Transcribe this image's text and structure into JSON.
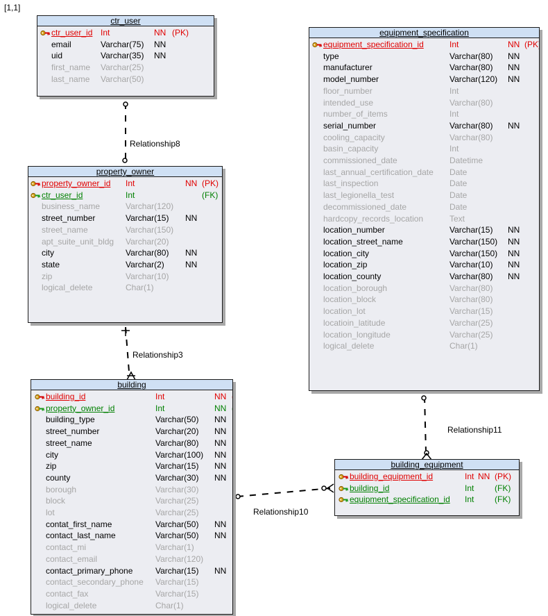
{
  "corner_label": "[1,1]",
  "colors": {
    "header_bg": "#cfe0f4",
    "entity_bg": "#ecedf2",
    "pk_color": "#e00000",
    "fk_color": "#008000",
    "optional_color": "#a6a6a6"
  },
  "relationships": [
    {
      "name": "Relationship8"
    },
    {
      "name": "Relationship3"
    },
    {
      "name": "Relationship11"
    },
    {
      "name": "Relationship10"
    }
  ],
  "entities": {
    "ctr_user": {
      "title": "ctr_user",
      "columns": [
        {
          "name": "ctr_user_id",
          "type": "Int",
          "nn": "NN",
          "key": "(PK)",
          "kind": "pk",
          "icon": "key-icon"
        },
        {
          "name": "email",
          "type": "Varchar(75)",
          "nn": "NN",
          "key": "",
          "kind": "req"
        },
        {
          "name": "uid",
          "type": "Varchar(35)",
          "nn": "NN",
          "key": "",
          "kind": "req"
        },
        {
          "name": "first_name",
          "type": "Varchar(25)",
          "nn": "",
          "key": "",
          "kind": "opt"
        },
        {
          "name": "last_name",
          "type": "Varchar(50)",
          "nn": "",
          "key": "",
          "kind": "opt"
        }
      ]
    },
    "property_owner": {
      "title": "property_owner",
      "columns": [
        {
          "name": "property_owner_id",
          "type": "Int",
          "nn": "NN",
          "key": "(PK)",
          "kind": "pk",
          "icon": "key-icon"
        },
        {
          "name": "ctr_user_id",
          "type": "Int",
          "nn": "",
          "key": "(FK)",
          "kind": "fk",
          "icon": "foreign-key-icon"
        },
        {
          "name": "business_name",
          "type": "Varchar(120)",
          "nn": "",
          "key": "",
          "kind": "opt"
        },
        {
          "name": "street_number",
          "type": "Varchar(15)",
          "nn": "NN",
          "key": "",
          "kind": "req"
        },
        {
          "name": "street_name",
          "type": "Varchar(150)",
          "nn": "",
          "key": "",
          "kind": "opt"
        },
        {
          "name": "apt_suite_unit_bldg",
          "type": "Varchar(20)",
          "nn": "",
          "key": "",
          "kind": "opt"
        },
        {
          "name": "city",
          "type": "Varchar(80)",
          "nn": "NN",
          "key": "",
          "kind": "req"
        },
        {
          "name": "state",
          "type": "Varchar(2)",
          "nn": "NN",
          "key": "",
          "kind": "req"
        },
        {
          "name": "zip",
          "type": "Varchar(10)",
          "nn": "",
          "key": "",
          "kind": "opt"
        },
        {
          "name": "logical_delete",
          "type": "Char(1)",
          "nn": "",
          "key": "",
          "kind": "opt"
        }
      ]
    },
    "building": {
      "title": "building",
      "columns": [
        {
          "name": "building_id",
          "type": "Int",
          "nn": "NN",
          "key": "(PK)",
          "kind": "pk",
          "icon": "key-icon"
        },
        {
          "name": "property_owner_id",
          "type": "Int",
          "nn": "NN",
          "key": "(FK)",
          "kind": "fk",
          "icon": "foreign-key-icon"
        },
        {
          "name": "building_type",
          "type": "Varchar(50)",
          "nn": "NN",
          "key": "",
          "kind": "req"
        },
        {
          "name": "street_number",
          "type": "Varchar(20)",
          "nn": "NN",
          "key": "",
          "kind": "req"
        },
        {
          "name": "street_name",
          "type": "Varchar(80)",
          "nn": "NN",
          "key": "",
          "kind": "req"
        },
        {
          "name": "city",
          "type": "Varchar(100)",
          "nn": "NN",
          "key": "",
          "kind": "req"
        },
        {
          "name": "zip",
          "type": "Varchar(15)",
          "nn": "NN",
          "key": "",
          "kind": "req"
        },
        {
          "name": "county",
          "type": "Varchar(30)",
          "nn": "NN",
          "key": "",
          "kind": "req"
        },
        {
          "name": "borough",
          "type": "Varchar(30)",
          "nn": "",
          "key": "",
          "kind": "opt"
        },
        {
          "name": "block",
          "type": "Varchar(25)",
          "nn": "",
          "key": "",
          "kind": "opt"
        },
        {
          "name": "lot",
          "type": "Varchar(25)",
          "nn": "",
          "key": "",
          "kind": "opt"
        },
        {
          "name": "contat_first_name",
          "type": "Varchar(50)",
          "nn": "NN",
          "key": "",
          "kind": "req"
        },
        {
          "name": "contact_last_name",
          "type": "Varchar(50)",
          "nn": "NN",
          "key": "",
          "kind": "req"
        },
        {
          "name": "contact_mi",
          "type": "Varchar(1)",
          "nn": "",
          "key": "",
          "kind": "opt"
        },
        {
          "name": "contact_email",
          "type": "Varchar(120)",
          "nn": "",
          "key": "",
          "kind": "opt"
        },
        {
          "name": "contact_primary_phone",
          "type": "Varchar(15)",
          "nn": "NN",
          "key": "",
          "kind": "req"
        },
        {
          "name": "contact_secondary_phone",
          "type": "Varchar(15)",
          "nn": "",
          "key": "",
          "kind": "opt"
        },
        {
          "name": "contact_fax",
          "type": "Varchar(15)",
          "nn": "",
          "key": "",
          "kind": "opt"
        },
        {
          "name": "logical_delete",
          "type": "Char(1)",
          "nn": "",
          "key": "",
          "kind": "opt"
        }
      ]
    },
    "equipment_specification": {
      "title": "equipment_specification",
      "columns": [
        {
          "name": "equipment_specification_id",
          "type": "Int",
          "nn": "NN",
          "key": "(PK)",
          "kind": "pk",
          "icon": "key-icon"
        },
        {
          "name": "type",
          "type": "Varchar(80)",
          "nn": "NN",
          "key": "",
          "kind": "req"
        },
        {
          "name": "manufacturer",
          "type": "Varchar(80)",
          "nn": "NN",
          "key": "",
          "kind": "req"
        },
        {
          "name": "model_number",
          "type": "Varchar(120)",
          "nn": "NN",
          "key": "",
          "kind": "req"
        },
        {
          "name": "floor_number",
          "type": "Int",
          "nn": "",
          "key": "",
          "kind": "opt"
        },
        {
          "name": "intended_use",
          "type": "Varchar(80)",
          "nn": "",
          "key": "",
          "kind": "opt"
        },
        {
          "name": "number_of_items",
          "type": "Int",
          "nn": "",
          "key": "",
          "kind": "opt"
        },
        {
          "name": "serial_number",
          "type": "Varchar(80)",
          "nn": "NN",
          "key": "",
          "kind": "req"
        },
        {
          "name": "cooling_capacity",
          "type": "Varchar(80)",
          "nn": "",
          "key": "",
          "kind": "opt"
        },
        {
          "name": "basin_capacity",
          "type": "Int",
          "nn": "",
          "key": "",
          "kind": "opt"
        },
        {
          "name": "commissioned_date",
          "type": "Datetime",
          "nn": "",
          "key": "",
          "kind": "opt"
        },
        {
          "name": "last_annual_certification_date",
          "type": "Date",
          "nn": "",
          "key": "",
          "kind": "opt"
        },
        {
          "name": "last_inspection",
          "type": "Date",
          "nn": "",
          "key": "",
          "kind": "opt"
        },
        {
          "name": "last_legionella_test",
          "type": "Date",
          "nn": "",
          "key": "",
          "kind": "opt"
        },
        {
          "name": "decommissioned_date",
          "type": "Date",
          "nn": "",
          "key": "",
          "kind": "opt"
        },
        {
          "name": "hardcopy_records_location",
          "type": "Text",
          "nn": "",
          "key": "",
          "kind": "opt"
        },
        {
          "name": "location_number",
          "type": "Varchar(15)",
          "nn": "NN",
          "key": "",
          "kind": "req"
        },
        {
          "name": "location_street_name",
          "type": "Varchar(150)",
          "nn": "NN",
          "key": "",
          "kind": "req"
        },
        {
          "name": "location_city",
          "type": "Varchar(150)",
          "nn": "NN",
          "key": "",
          "kind": "req"
        },
        {
          "name": "location_zip",
          "type": "Varchar(10)",
          "nn": "NN",
          "key": "",
          "kind": "req"
        },
        {
          "name": "location_county",
          "type": "Varchar(80)",
          "nn": "NN",
          "key": "",
          "kind": "req"
        },
        {
          "name": "location_borough",
          "type": "Varchar(80)",
          "nn": "",
          "key": "",
          "kind": "opt"
        },
        {
          "name": "location_block",
          "type": "Varchar(80)",
          "nn": "",
          "key": "",
          "kind": "opt"
        },
        {
          "name": "location_lot",
          "type": "Varchar(15)",
          "nn": "",
          "key": "",
          "kind": "opt"
        },
        {
          "name": "locatioin_latitude",
          "type": "Varchar(25)",
          "nn": "",
          "key": "",
          "kind": "opt"
        },
        {
          "name": "location_longitude",
          "type": "Varchar(25)",
          "nn": "",
          "key": "",
          "kind": "opt"
        },
        {
          "name": "logical_delete",
          "type": "Char(1)",
          "nn": "",
          "key": "",
          "kind": "opt"
        }
      ]
    },
    "building_equipment": {
      "title": "building_equipment",
      "columns": [
        {
          "name": "building_equipment_id",
          "type": "Int",
          "nn": "NN",
          "key": "(PK)",
          "kind": "pk",
          "icon": "key-icon"
        },
        {
          "name": "building_id",
          "type": "Int",
          "nn": "",
          "key": "(FK)",
          "kind": "fk",
          "icon": "foreign-key-icon"
        },
        {
          "name": "equipment_specification_id",
          "type": "Int",
          "nn": "",
          "key": "(FK)",
          "kind": "fk",
          "icon": "foreign-key-icon"
        }
      ]
    }
  }
}
